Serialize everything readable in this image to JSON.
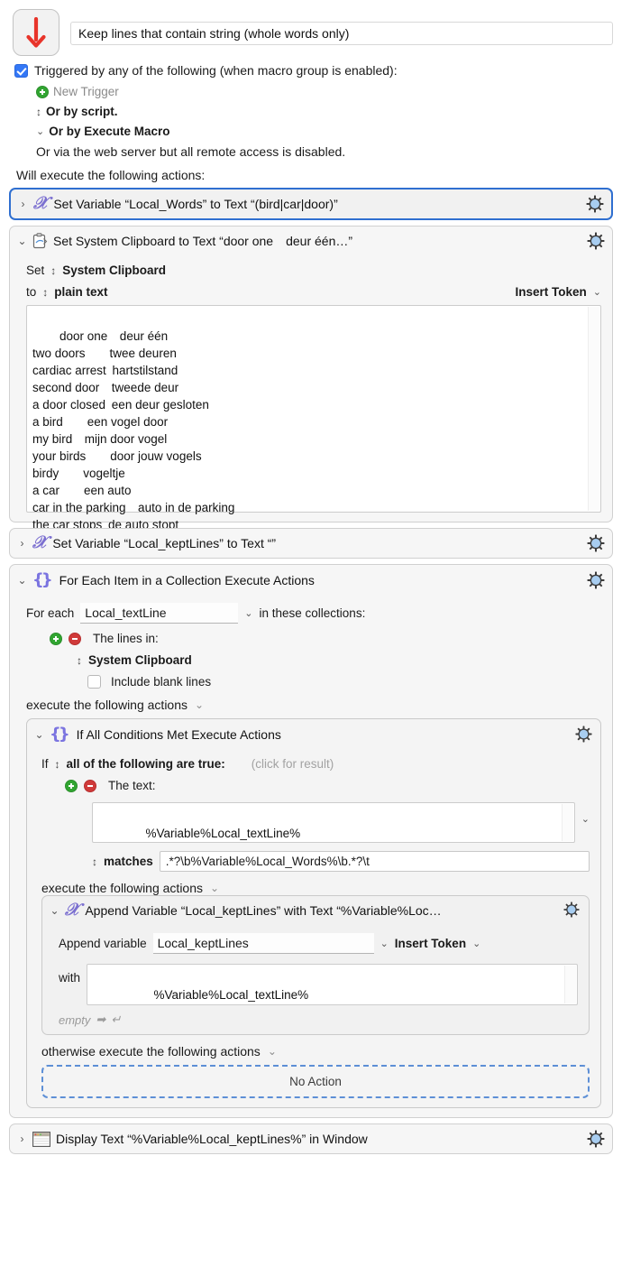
{
  "macro": {
    "icon": "red-down-arrow-icon",
    "title": "Keep lines that contain string (whole words only)"
  },
  "triggers": {
    "enabled_checkbox_label": "Triggered by any of the following (when macro group is enabled):",
    "new_trigger_label": "New Trigger",
    "by_script_label": "Or by script.",
    "by_execute_macro_label": "Or by Execute Macro",
    "web_server_note": "Or via the web server but all remote access is disabled."
  },
  "actions_header": "Will execute the following actions:",
  "action1": {
    "title": "Set Variable “Local_Words” to Text “(bird|car|door)”",
    "disclosure": "›"
  },
  "action2": {
    "title": "Set System Clipboard to Text “door one deur één…”",
    "disclosure": "⌄",
    "set_label": "Set",
    "destination": "System Clipboard",
    "to_label": "to",
    "format": "plain text",
    "insert_token_label": "Insert Token",
    "clipboard_text": "door one deur één\ntwo doors  twee deuren\ncardiac arrest hartstilstand\nsecond door  tweede deur\na door closed een deur gesloten\na bird  een vogel door\nmy bird  mijn door vogel\nyour birds  door jouw vogels\nbirdy  vogeltje\na car  een auto\ncar in the parking auto in de parking\nthe car stops de auto stopt"
  },
  "action3": {
    "title": "Set Variable “Local_keptLines” to Text “”",
    "disclosure": "›"
  },
  "action4": {
    "title": "For Each Item in a Collection Execute Actions",
    "disclosure": "⌄",
    "for_each_label": "For each",
    "for_each_variable": "Local_textLine",
    "in_collections_label": "in these collections:",
    "the_lines_in_label": "The lines in:",
    "source": "System Clipboard",
    "include_blank_lines_label": "Include blank lines",
    "include_blank_lines_checked": false,
    "execute_label": "execute the following actions"
  },
  "action5": {
    "title": "If All Conditions Met Execute Actions",
    "disclosure": "⌄",
    "if_label": "If",
    "condition_mode": "all of the following are true:",
    "click_for_result": "(click for result)",
    "the_text_label": "The text:",
    "text_value": "%Variable%Local_textLine%",
    "operator": "matches",
    "pattern": ".*?\\b%Variable%Local_Words%\\b.*?\\t",
    "execute_label": "execute the following actions",
    "otherwise_label": "otherwise execute the following actions",
    "no_action_label": "No Action"
  },
  "action6": {
    "title": "Append Variable “Local_keptLines” with Text “%Variable%Loc…",
    "disclosure": "⌄",
    "append_variable_label": "Append variable",
    "append_variable_value": "Local_keptLines",
    "insert_token_label": "Insert Token",
    "with_label": "with",
    "with_value": "%Variable%Local_textLine%",
    "empty_hint": "empty"
  },
  "action7": {
    "title": "Display Text “%Variable%Local_keptLines%” in Window",
    "disclosure": "›"
  },
  "colors": {
    "selection_blue": "#2f6fd0",
    "checkbox_blue": "#3478f6",
    "gear_blue": "#a8cdf0",
    "add_green": "#31a531",
    "remove_red": "#d03a3a",
    "arrow_red": "#e8342a",
    "variable_purple": "#7b6fd0",
    "dashed_blue": "#5d8fd6"
  }
}
